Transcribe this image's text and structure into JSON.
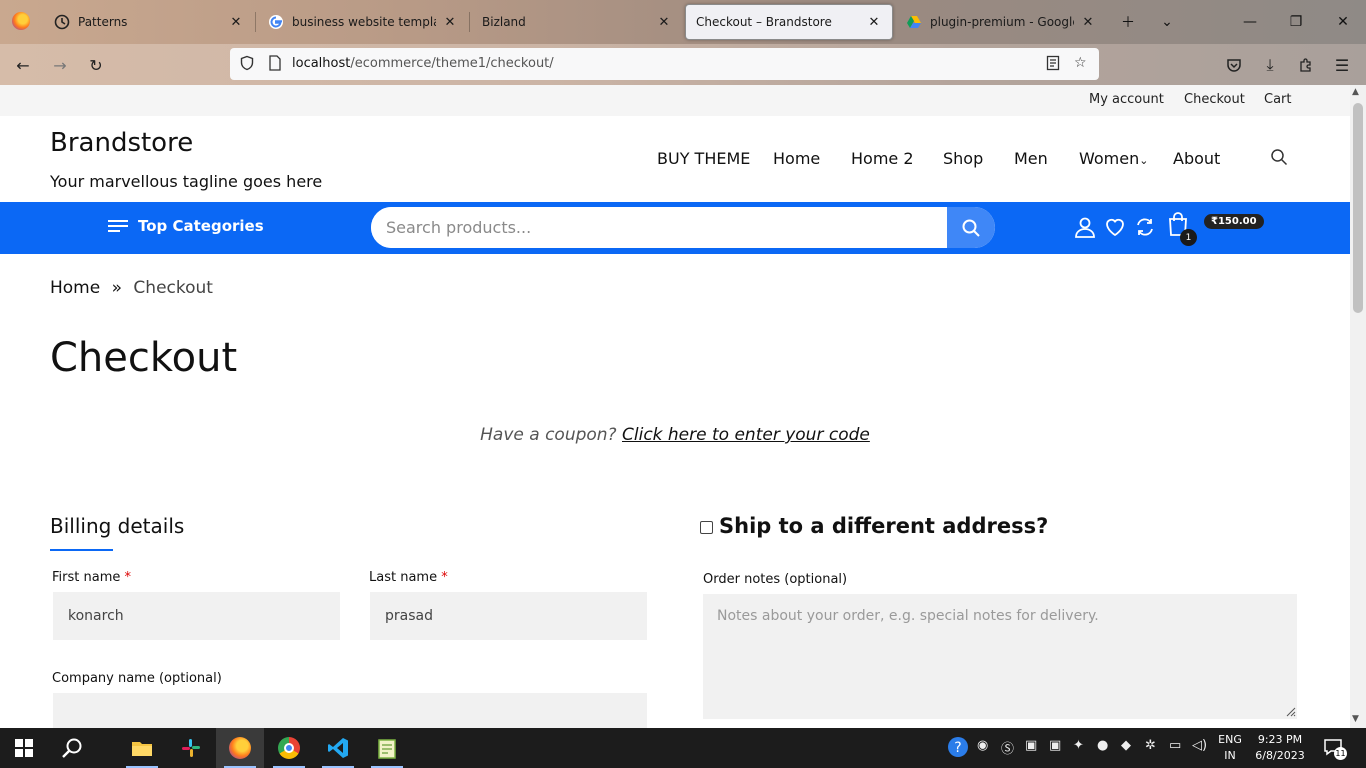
{
  "browser": {
    "tabs": [
      {
        "label": "Patterns",
        "icon": "clock-icon"
      },
      {
        "label": "business website templates fr",
        "icon": "google-icon"
      },
      {
        "label": "Bizland",
        "icon": ""
      },
      {
        "label": "Checkout – Brandstore",
        "icon": "",
        "active": true
      },
      {
        "label": "plugin-premium - Google D",
        "icon": "google-drive-icon"
      }
    ],
    "url_host": "localhost",
    "url_path": "/ecommerce/theme1/checkout/"
  },
  "site": {
    "top_links": [
      "My account",
      "Checkout",
      "Cart"
    ],
    "brand": "Brandstore",
    "tagline": "Your marvellous tagline goes here",
    "nav": [
      "BUY THEME",
      "Home",
      "Home 2",
      "Shop",
      "Men",
      "Women",
      "About"
    ],
    "nav_women_caret": "⌄",
    "top_categories": "Top Categories",
    "search_placeholder": "Search products...",
    "cart_count": "1",
    "cart_total": "₹150.00",
    "accent_color": "#0b68f5"
  },
  "breadcrumb": {
    "home": "Home",
    "sep": "»",
    "current": "Checkout"
  },
  "page": {
    "title": "Checkout",
    "coupon_prompt": "Have a coupon?",
    "coupon_link": "Click here to enter your code"
  },
  "billing": {
    "title": "Billing details",
    "first_name_label": "First name",
    "first_name_value": "konarch",
    "last_name_label": "Last name",
    "last_name_value": "prasad",
    "company_label": "Company name (optional)",
    "company_value": "",
    "required_mark": "*"
  },
  "shipping": {
    "ship_label": "Ship to a different address?",
    "ship_checked": false,
    "notes_label": "Order notes (optional)",
    "notes_placeholder": "Notes about your order, e.g. special notes for delivery."
  },
  "taskbar": {
    "lang_top": "ENG",
    "lang_bottom": "IN",
    "time": "9:23 PM",
    "date": "6/8/2023",
    "notif_count": "11"
  }
}
